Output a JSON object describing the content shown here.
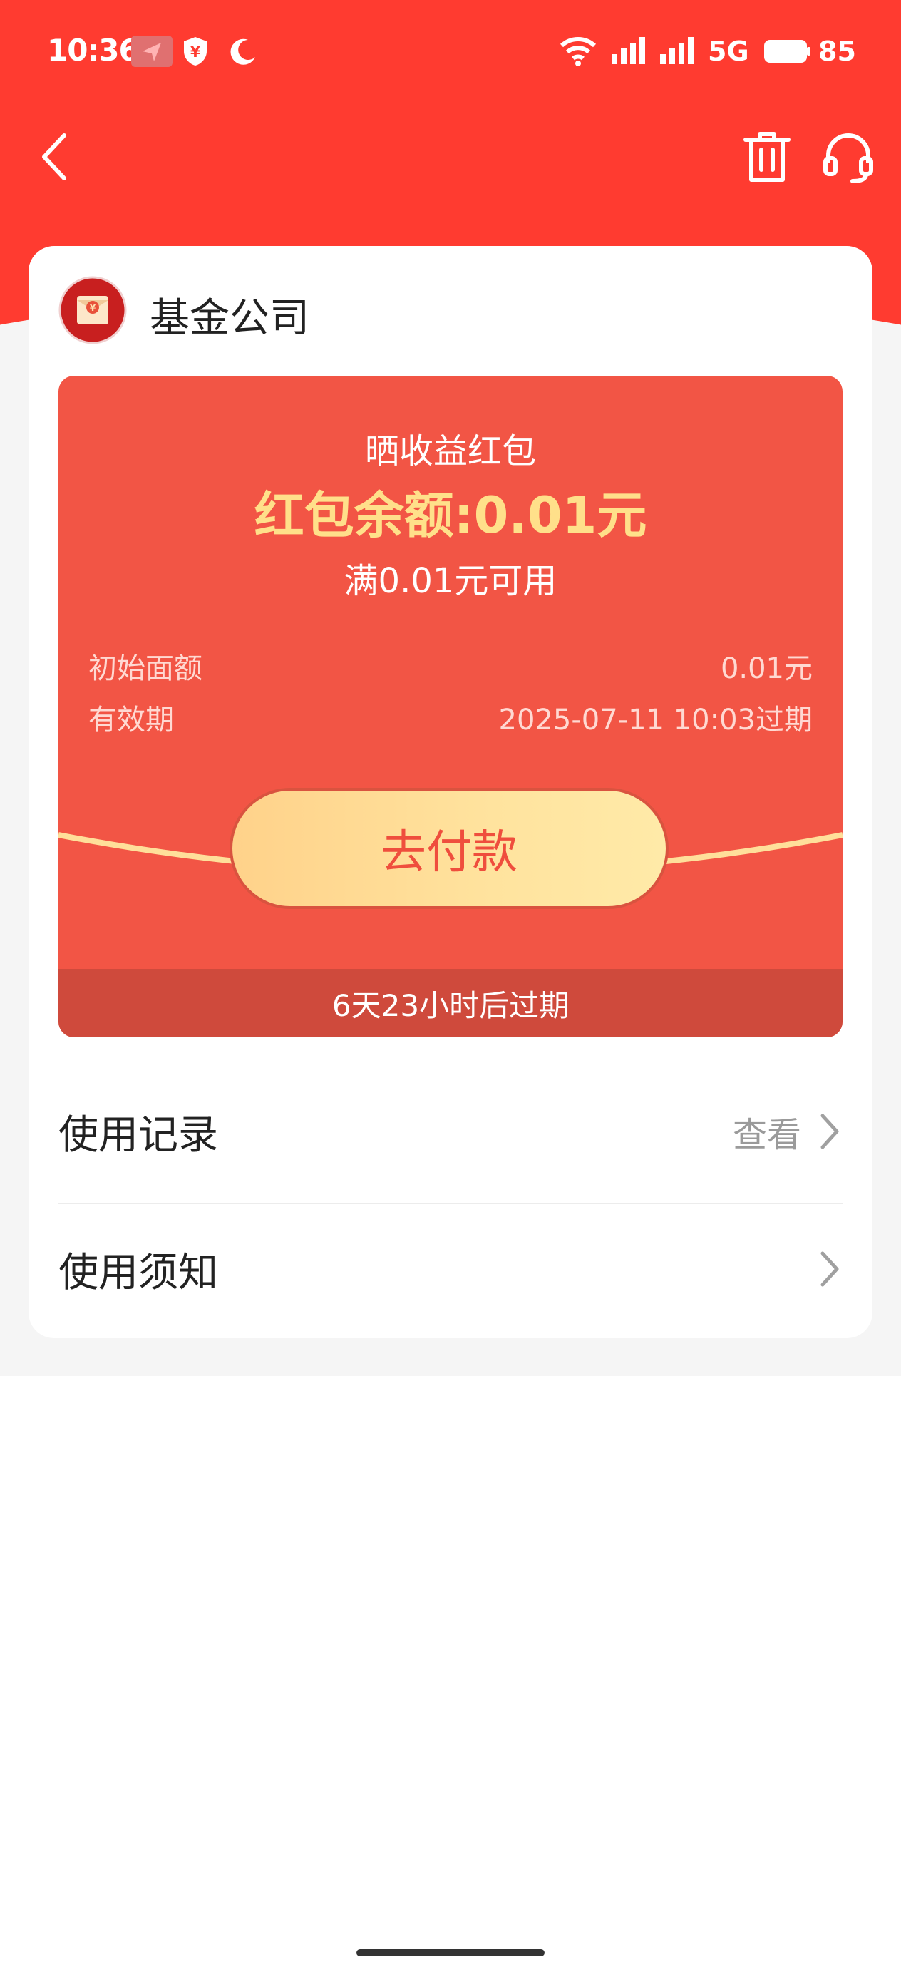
{
  "status_bar": {
    "time": "10:36",
    "network": "5G",
    "battery": "85"
  },
  "nav": {
    "icons": [
      "back-icon",
      "trash-icon",
      "customer-service-icon"
    ]
  },
  "company": {
    "name": "基金公司"
  },
  "packet": {
    "title": "晒收益红包",
    "balance": "红包余额:0.01元",
    "threshold": "满0.01元可用",
    "initial_label": "初始面额",
    "initial_value": "0.01元",
    "validity_label": "有效期",
    "validity_value": "2025-07-11 10:03过期",
    "pay_button": "去付款",
    "expire_notice": "6天23小时后过期"
  },
  "rows": [
    {
      "label": "使用记录",
      "action": "查看"
    },
    {
      "label": "使用须知",
      "action": ""
    }
  ],
  "colors": {
    "header_red": "#ff3b30",
    "packet_red": "#f25545",
    "balance_gold": "#ffe08a",
    "button_gold": "#ffd28a"
  }
}
